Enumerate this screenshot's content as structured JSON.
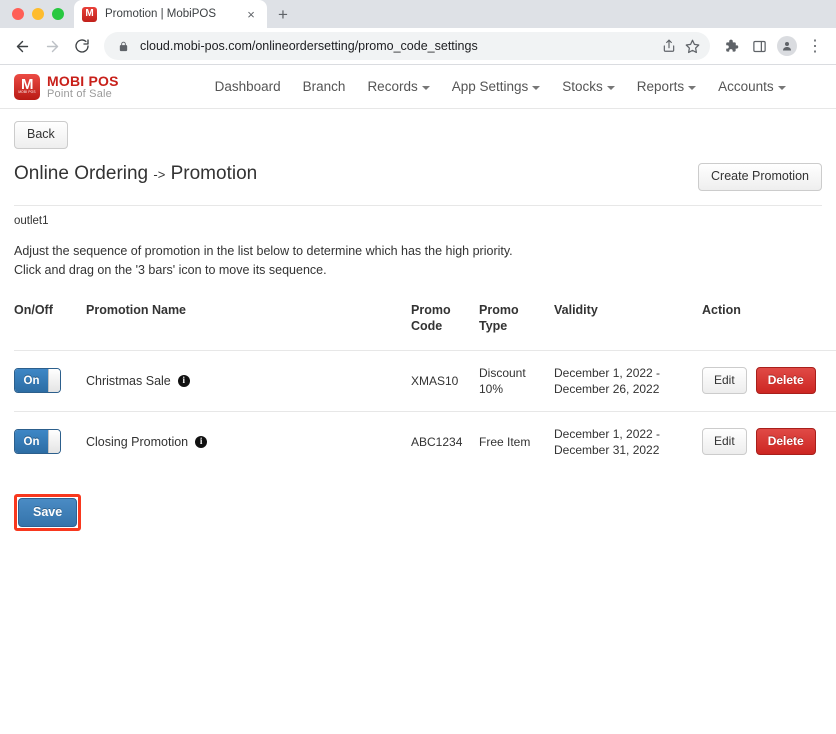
{
  "browser": {
    "tab": {
      "title": "Promotion | MobiPOS",
      "favicon_name": "mobipos-favicon",
      "favicon_glyph": "M",
      "close_glyph": "×"
    },
    "new_tab_glyph": "+",
    "nav": {
      "back_glyph": "←",
      "forward_glyph": "→",
      "reload_glyph": "⟳"
    },
    "omnibox": {
      "lock_glyph": "🔒",
      "url": "cloud.mobi-pos.com/onlineordersetting/promo_code_settings",
      "share_glyph": "↑",
      "bookmark_glyph": "☆"
    },
    "toolbar_icons": [
      "extensions-icon",
      "side-panel-icon",
      "profile-icon",
      "chrome-menu-icon"
    ],
    "menu_glyph": "⋮"
  },
  "brand": {
    "mark_letter": "M",
    "mark_sub": "MOBI POS",
    "name": "MOBI POS",
    "tagline": "Point of Sale",
    "color": "#c8201a"
  },
  "topnav": {
    "items": [
      {
        "label": "Dashboard",
        "has_caret": false
      },
      {
        "label": "Branch",
        "has_caret": false
      },
      {
        "label": "Records",
        "has_caret": true
      },
      {
        "label": "App Settings",
        "has_caret": true
      },
      {
        "label": "Stocks",
        "has_caret": true
      },
      {
        "label": "Reports",
        "has_caret": true
      },
      {
        "label": "Accounts",
        "has_caret": true
      }
    ]
  },
  "page": {
    "back_label": "Back",
    "title_main": "Online Ordering",
    "title_arrow": "->",
    "title_sub": "Promotion",
    "create_label": "Create Promotion",
    "outlet": "outlet1",
    "note_line1": "Adjust the sequence of promotion in the list below to determine which has the high priority.",
    "note_line2": "Click and drag on the '3 bars' icon to move its sequence.",
    "save_label": "Save",
    "save_highlight_color": "#f8381e"
  },
  "table": {
    "headers": {
      "onoff": "On/Off",
      "name": "Promotion Name",
      "code_l1": "Promo",
      "code_l2": "Code",
      "type_l1": "Promo",
      "type_l2": "Type",
      "validity": "Validity",
      "action": "Action"
    },
    "edit_label": "Edit",
    "delete_label": "Delete",
    "info_glyph": "i",
    "rows": [
      {
        "toggle_state": "On",
        "name": "Christmas Sale",
        "code": "XMAS10",
        "type": "Discount 10%",
        "validity": "December 1, 2022 - December 26, 2022"
      },
      {
        "toggle_state": "On",
        "name": "Closing Promotion",
        "code": "ABC1234",
        "type": "Free Item",
        "validity": "December 1, 2022 - December 31, 2022"
      }
    ]
  }
}
